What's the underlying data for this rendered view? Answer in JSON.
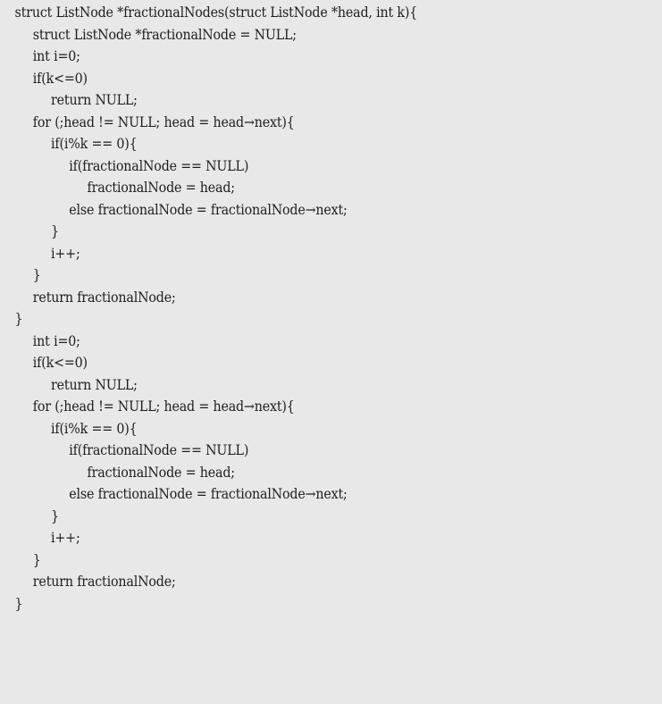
{
  "document": {
    "lines": [
      {
        "text": "struct ListNode *fractionalNodes(struct ListNode *head, int k){",
        "indent": 0
      },
      {
        "text": "struct ListNode *fractionalNode = NULL;",
        "indent": 1
      },
      {
        "text": "int i=0;",
        "indent": 1
      },
      {
        "text": "if(k<=0)",
        "indent": 1
      },
      {
        "text": "return NULL;",
        "indent": 2
      },
      {
        "text": "for (;head != NULL; head = head→next){",
        "indent": 1
      },
      {
        "text": "if(i%k == 0){",
        "indent": 2
      },
      {
        "text": "if(fractionalNode == NULL)",
        "indent": 3
      },
      {
        "text": "fractionalNode = head;",
        "indent": 4
      },
      {
        "text": "else fractionalNode = fractionalNode→next;",
        "indent": 3
      },
      {
        "text": "}",
        "indent": 2
      },
      {
        "text": "i++;",
        "indent": 2
      },
      {
        "text": "}",
        "indent": 1
      },
      {
        "text": "return fractionalNode;",
        "indent": 1
      },
      {
        "text": "}",
        "indent": 0
      },
      {
        "text": "int i=0;",
        "indent": 1
      },
      {
        "text": "if(k<=0)",
        "indent": 1
      },
      {
        "text": "return NULL;",
        "indent": 2
      },
      {
        "text": "for (;head != NULL; head = head→next){",
        "indent": 1
      },
      {
        "text": "if(i%k == 0){",
        "indent": 2
      },
      {
        "text": "if(fractionalNode == NULL)",
        "indent": 3
      },
      {
        "text": "fractionalNode = head;",
        "indent": 4
      },
      {
        "text": "else fractionalNode = fractionalNode→next;",
        "indent": 3
      },
      {
        "text": "}",
        "indent": 2
      },
      {
        "text": "i++;",
        "indent": 2
      },
      {
        "text": "}",
        "indent": 1
      },
      {
        "text": "return fractionalNode;",
        "indent": 1
      },
      {
        "text": "}",
        "indent": 0
      }
    ]
  },
  "colors": {
    "background": "#e8e8e8",
    "text": "#1e1e1e"
  }
}
